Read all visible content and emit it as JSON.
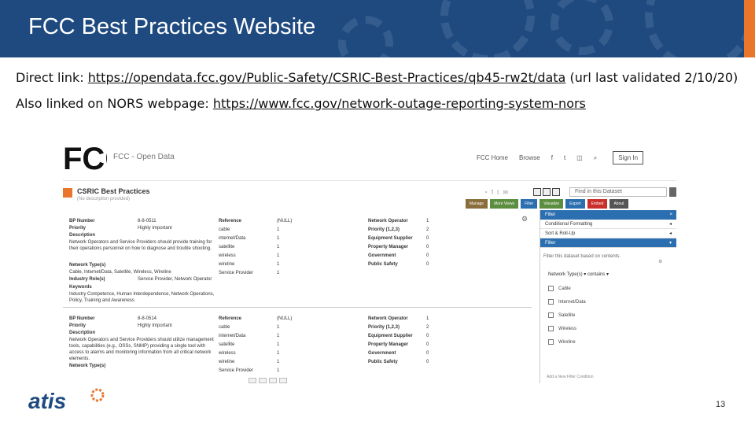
{
  "slide": {
    "title": "FCC Best Practices Website",
    "direct_link_prefix": "Direct link: ",
    "direct_link_url": "https://opendata.fcc.gov/Public-Safety/CSRIC-Best-Practices/qb45-rw2t/data",
    "direct_link_suffix": " (url last validated 2/10/20)",
    "also_linked_prefix": "Also linked on NORS webpage: ",
    "also_linked_url": "https://www.fcc.gov/network-outage-reporting-system-nors",
    "page_number": "13",
    "footer_logo": "atis"
  },
  "colors": {
    "title_bar": "#1e4a80",
    "accent": "#e9762b",
    "filter_blue": "#2c6fb0"
  },
  "screenshot": {
    "logo_text": "FCC",
    "site_name": "FCC - Open Data",
    "nav": {
      "home": "FCC Home",
      "browse": "Browse",
      "sign_in": "Sign In"
    },
    "dataset_title": "CSRIC Best Practices",
    "dataset_subtitle": "(No description provided)",
    "find_placeholder": "Find in this Dataset",
    "buttons": [
      {
        "label": "Manage",
        "color": "#8a6d3b"
      },
      {
        "label": "More Views",
        "color": "#5b8e3e"
      },
      {
        "label": "Filter",
        "color": "#2c6fb0"
      },
      {
        "label": "Visualize",
        "color": "#5b8e3e"
      },
      {
        "label": "Export",
        "color": "#2c6fb0"
      },
      {
        "label": "Embed",
        "color": "#c9302c"
      },
      {
        "label": "About",
        "color": "#555555"
      }
    ],
    "record1": {
      "bp_number_label": "BP Number",
      "bp_number": "8-8-0511",
      "priority_label": "Priority",
      "priority": "Highly Important",
      "description_label": "Description",
      "description": "Network Operators and Service Providers should provide training for their operations personnel on how to diagnose and trouble shooting.",
      "network_type_label": "Network Type(s)",
      "network_type": "Cable, Internet/Data, Satellite, Wireless, Wireline",
      "industry_role_label": "Industry Role(s)",
      "industry_role": "Service Provider, Network Operator",
      "keywords_label": "Keywords",
      "keywords": "Industry Competence, Human Interdependence, Network Operations, Policy, Training and Awareness",
      "reference_label": "Reference",
      "reference": "(NULL)",
      "mid": [
        [
          "cable",
          "1"
        ],
        [
          "internet/Data",
          "1"
        ],
        [
          "satellite",
          "1"
        ],
        [
          "wireless",
          "1"
        ],
        [
          "wireline",
          "1"
        ],
        [
          "Service Provider",
          "1"
        ]
      ],
      "right": [
        [
          "Network Operator",
          "1"
        ],
        [
          "Priority (1,2,3)",
          "2"
        ],
        [
          "Equipment Supplier",
          "0"
        ],
        [
          "Property Manager",
          "0"
        ],
        [
          "Government",
          "0"
        ],
        [
          "Public Safety",
          "0"
        ]
      ]
    },
    "record2": {
      "bp_number_label": "BP Number",
      "bp_number": "8-8-0514",
      "priority_label": "Priority",
      "priority": "Highly Important",
      "description_label": "Description",
      "description": "Network Operators and Service Providers should utilize management tools, capabilities (e.g., OSSs, SNMP) providing a single tool with access to alarms and monitoring information from all critical network elements.",
      "network_type_label": "Network Type(s)",
      "reference_label": "Reference",
      "reference": "(NULL)",
      "mid": [
        [
          "cable",
          "1"
        ],
        [
          "internet/Data",
          "1"
        ],
        [
          "satellite",
          "1"
        ],
        [
          "wireless",
          "1"
        ],
        [
          "wireline",
          "1"
        ],
        [
          "Service Provider",
          "1"
        ]
      ],
      "right": [
        [
          "Network Operator",
          "1"
        ],
        [
          "Priority (1,2,3)",
          "2"
        ],
        [
          "Equipment Supplier",
          "0"
        ],
        [
          "Property Manager",
          "0"
        ],
        [
          "Government",
          "0"
        ],
        [
          "Public Safety",
          "0"
        ]
      ]
    },
    "filter_panel": {
      "header": "Filter",
      "conditional": "Conditional Formatting",
      "sort": "Sort & Roll-Up",
      "filter": "Filter",
      "hint": "Filter this dataset based on contents.",
      "column": "Network Type(s)",
      "operator": "contains",
      "options": [
        "Cable",
        "Internet/Data",
        "Satellite",
        "Wireless",
        "Wireline"
      ],
      "footer": "Add a New Filter Condition"
    }
  }
}
